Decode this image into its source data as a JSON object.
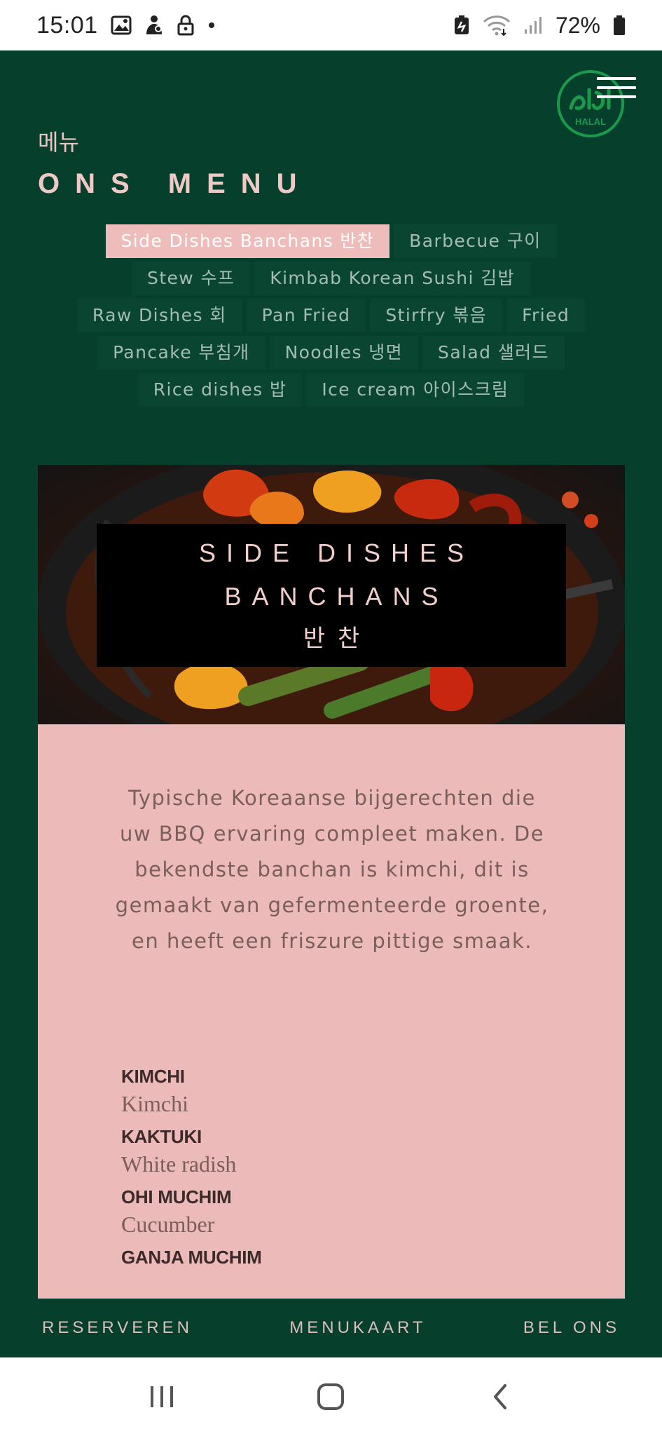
{
  "status_bar": {
    "time": "15:01",
    "battery": "72%",
    "icons": [
      "gallery-icon",
      "notification-icon",
      "lock-icon",
      "dot-icon",
      "battery-saver-icon",
      "wifi-icon",
      "signal-icon",
      "battery-icon"
    ]
  },
  "header": {
    "logo_text": "HALAL",
    "menu_icon": "hamburger-icon",
    "title_kr": "메뉴",
    "title": "ONS MENU"
  },
  "tabs": [
    [
      {
        "label": "Side Dishes Banchans 반찬",
        "active": true
      },
      {
        "label": "Barbecue 구이"
      }
    ],
    [
      {
        "label": "Stew 수프"
      },
      {
        "label": "Kimbab Korean Sushi 김밥"
      }
    ],
    [
      {
        "label": "Raw Dishes 회"
      },
      {
        "label": "Pan Fried"
      },
      {
        "label": "Stirfry 볶음"
      },
      {
        "label": "Fried"
      }
    ],
    [
      {
        "label": "Pancake 부침개"
      },
      {
        "label": "Noodles 냉면"
      },
      {
        "label": "Salad 샐러드"
      }
    ],
    [
      {
        "label": "Rice dishes 밥"
      },
      {
        "label": "Ice cream 아이스크림"
      }
    ]
  ],
  "section": {
    "title_line1": "SIDE DISHES",
    "title_line2": "BANCHANS",
    "title_kr": "반찬",
    "description": "Typische Koreaanse bijgerechten die uw BBQ ervaring compleet maken. De bekendste banchan is kimchi, dit is gemaakt van gefermenteerde groente, en heeft een friszure pittige smaak.",
    "dishes": [
      {
        "name": "KIMCHI",
        "sub": "Kimchi"
      },
      {
        "name": "KAKTUKI",
        "sub": "White radish"
      },
      {
        "name": "OHI MUCHIM",
        "sub": "Cucumber"
      },
      {
        "name": "GANJA MUCHIM",
        "sub": ""
      }
    ]
  },
  "actions": {
    "reserve": "RESERVEREN",
    "menu": "MENUKAART",
    "call": "BEL ONS"
  },
  "colors": {
    "background": "#063f2c",
    "accent_pink": "#ecbab8",
    "title_pink": "#efc9c6"
  }
}
